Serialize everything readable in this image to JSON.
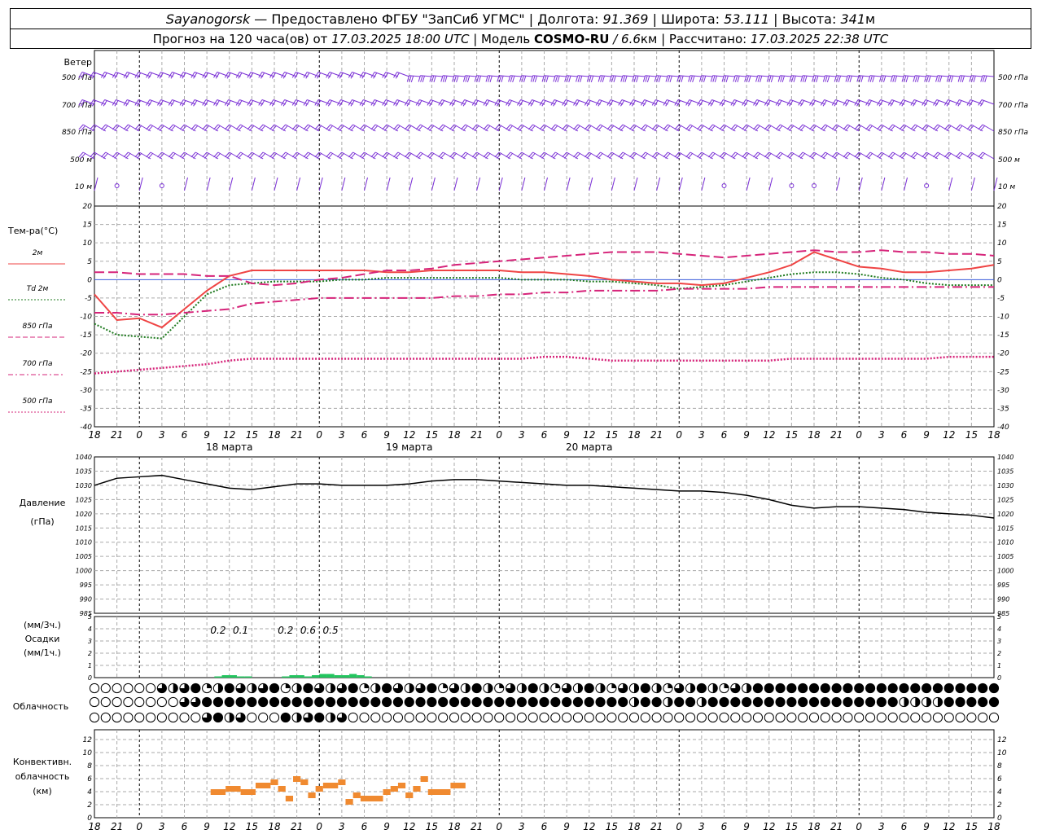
{
  "header": {
    "line1": {
      "station": "Sayanogorsk",
      "provider": " — Предоставлено ФГБУ \"ЗапСиб УГМС\" | Долгота: ",
      "lon": "91.369",
      "lat_label": " | Широта: ",
      "lat": "53.111",
      "alt_label": " | Высота: ",
      "alt": "341",
      "alt_unit": "м"
    },
    "line2": {
      "fc_label": "Прогноз на 120 часа(ов) от ",
      "fc_start": "17.03.2025 18:00 UTC",
      "model_label": " | Модель ",
      "model": "COSMO-RU",
      "res": " / 6.6",
      "res_unit": "км",
      "calc_label": " | Рассчитано: ",
      "calc": "17.03.2025 22:38 UTC"
    }
  },
  "chart_data": [
    {
      "type": "wind-barbs",
      "title": "Ветер",
      "levels": [
        "500 гПа",
        "700 гПа",
        "850 гПа",
        "500 м",
        "10 м"
      ],
      "color": "#7a2fd6",
      "calm_markers_10m_hours": [
        3,
        9,
        85,
        92,
        94,
        96,
        112
      ]
    },
    {
      "type": "line",
      "ylabel": "Тем-ра(°C)",
      "ylim": [
        -40,
        20
      ],
      "yticks": [
        20,
        15,
        10,
        5,
        0,
        -5,
        -10,
        -15,
        -20,
        -25,
        -30,
        -35,
        -40
      ],
      "x_hours": [
        0,
        3,
        6,
        9,
        12,
        15,
        18,
        21,
        24,
        27,
        30,
        33,
        36,
        39,
        42,
        45,
        48,
        51,
        54,
        57,
        60,
        63,
        66,
        69,
        72,
        75,
        78,
        81,
        84,
        87,
        90,
        93,
        96,
        99,
        102,
        105,
        108,
        111,
        114,
        117,
        120
      ],
      "series": [
        {
          "name": "2м",
          "color": "#ef4444",
          "style": "solid",
          "values": [
            -4,
            -11,
            -10.5,
            -13,
            -8,
            -3,
            1,
            2.5,
            2.5,
            2.5,
            2.5,
            2.5,
            2.5,
            2,
            2,
            2.5,
            2.5,
            2.5,
            2.5,
            2,
            2,
            1.5,
            1,
            0,
            -0.5,
            -1,
            -1,
            -1.5,
            -1,
            0.5,
            2,
            4,
            7.5,
            5.5,
            3.5,
            3,
            2,
            2,
            2.5,
            3,
            4
          ]
        },
        {
          "name": "Td 2м",
          "color": "#1e7a1e",
          "style": "dotted",
          "values": [
            -12,
            -15,
            -15.5,
            -16,
            -10,
            -4,
            -1.5,
            -1,
            -0.5,
            -0.5,
            -0.5,
            0,
            0,
            0.5,
            0.5,
            0.5,
            0.5,
            0.5,
            0.5,
            0,
            0,
            0,
            -0.5,
            -0.5,
            -1,
            -1.5,
            -2.5,
            -2,
            -1.5,
            -0.5,
            0.5,
            1.5,
            2,
            2,
            1.5,
            0.5,
            0,
            -1,
            -1.5,
            -1.5,
            -1.5
          ]
        },
        {
          "name": "850 гПа",
          "color": "#d6247a",
          "style": "dash",
          "values": [
            2,
            2,
            1.5,
            1.5,
            1.5,
            1,
            1,
            -1,
            -1.5,
            -1,
            0,
            0.5,
            1.5,
            2.5,
            2.5,
            3,
            4,
            4.5,
            5,
            5.5,
            6,
            6.5,
            7,
            7.5,
            7.5,
            7.5,
            7,
            6.5,
            6,
            6.5,
            7,
            7.5,
            8,
            7.5,
            7.5,
            8,
            7.5,
            7.5,
            7,
            7,
            6.5
          ]
        },
        {
          "name": "700 гПа",
          "color": "#d6247a",
          "style": "dashdot",
          "values": [
            -9,
            -9,
            -9.5,
            -9.5,
            -9,
            -8.5,
            -8,
            -6.5,
            -6,
            -5.5,
            -5,
            -5,
            -5,
            -5,
            -5,
            -5,
            -4.5,
            -4.5,
            -4,
            -4,
            -3.5,
            -3.5,
            -3,
            -3,
            -3,
            -3,
            -2.5,
            -2.5,
            -2.5,
            -2.5,
            -2,
            -2,
            -2,
            -2,
            -2,
            -2,
            -2,
            -2,
            -2,
            -2,
            -2
          ]
        },
        {
          "name": "500 гПа",
          "color": "#d6247a",
          "style": "dotted",
          "values": [
            -25.5,
            -25,
            -24.5,
            -24,
            -23.5,
            -23,
            -22,
            -21.5,
            -21.5,
            -21.5,
            -21.5,
            -21.5,
            -21.5,
            -21.5,
            -21.5,
            -21.5,
            -21.5,
            -21.5,
            -21.5,
            -21.5,
            -21,
            -21,
            -21.5,
            -22,
            -22,
            -22,
            -22,
            -22,
            -22,
            -22,
            -22,
            -21.5,
            -21.5,
            -21.5,
            -21.5,
            -21.5,
            -21.5,
            -21.5,
            -21,
            -21,
            -21
          ]
        }
      ],
      "x_tick_labels": [
        "18",
        "21",
        "0",
        "3",
        "6",
        "9",
        "12",
        "15",
        "18",
        "21",
        "0",
        "3",
        "6",
        "9",
        "12",
        "15",
        "18",
        "21",
        "0",
        "3",
        "6",
        "9",
        "12",
        "15",
        "18",
        "21",
        "0",
        "3",
        "6",
        "9",
        "12",
        "15",
        "18",
        "21",
        "0",
        "3",
        "6",
        "9",
        "12",
        "15",
        "18",
        "21",
        "0"
      ],
      "day_labels": [
        {
          "hour": 18,
          "label": "18 марта"
        },
        {
          "hour": 42,
          "label": "19 марта"
        },
        {
          "hour": 66,
          "label": "20 марта"
        }
      ]
    },
    {
      "type": "line",
      "ylabel": "Давление",
      "yunit": "(гПа)",
      "ylim": [
        985,
        1040
      ],
      "yticks": [
        1040,
        1035,
        1030,
        1025,
        1020,
        1015,
        1010,
        1005,
        1000,
        995,
        990,
        985
      ],
      "color": "#000000",
      "x_hours": [
        0,
        3,
        6,
        9,
        12,
        15,
        18,
        21,
        24,
        27,
        30,
        33,
        36,
        39,
        42,
        45,
        48,
        51,
        54,
        57,
        60,
        63,
        66,
        69,
        72,
        75,
        78,
        81,
        84,
        87,
        90,
        93,
        96,
        99,
        102,
        105,
        108,
        111,
        114,
        117,
        120
      ],
      "values": [
        1030,
        1032.5,
        1033,
        1033.5,
        1032,
        1030.5,
        1029,
        1028.5,
        1029.5,
        1030.5,
        1030.5,
        1030,
        1030,
        1030,
        1030.5,
        1031.5,
        1032,
        1032,
        1031.5,
        1031,
        1030.5,
        1030,
        1030,
        1029.5,
        1029,
        1028.5,
        1028,
        1028,
        1027.5,
        1026.5,
        1025,
        1023,
        1022,
        1022.5,
        1022.5,
        1022,
        1021.5,
        1020.5,
        1020,
        1019.5,
        1018.5
      ]
    },
    {
      "type": "bar",
      "ylabel_lines": [
        "(мм/3ч.)",
        "Осадки",
        "(мм/1ч.)"
      ],
      "ylim": [
        0,
        5
      ],
      "yticks": [
        5,
        4,
        3,
        2,
        1,
        0
      ],
      "color": "#22c55e",
      "hourly": [
        {
          "hour": 16,
          "value": 0.1
        },
        {
          "hour": 17,
          "value": 0.2
        },
        {
          "hour": 18,
          "value": 0.2
        },
        {
          "hour": 19,
          "value": 0.1
        },
        {
          "hour": 20,
          "value": 0.1
        },
        {
          "hour": 25,
          "value": 0.1
        },
        {
          "hour": 26,
          "value": 0.2
        },
        {
          "hour": 27,
          "value": 0.2
        },
        {
          "hour": 28,
          "value": 0.1
        },
        {
          "hour": 29,
          "value": 0.2
        },
        {
          "hour": 30,
          "value": 0.3
        },
        {
          "hour": 31,
          "value": 0.3
        },
        {
          "hour": 32,
          "value": 0.2
        },
        {
          "hour": 33,
          "value": 0.2
        },
        {
          "hour": 34,
          "value": 0.3
        },
        {
          "hour": 35,
          "value": 0.2
        },
        {
          "hour": 36,
          "value": 0.1
        }
      ],
      "three_hour_labels": [
        {
          "hour": 16.5,
          "label": "0.2"
        },
        {
          "hour": 19.5,
          "label": "0.1"
        },
        {
          "hour": 25.5,
          "label": "0.2"
        },
        {
          "hour": 28.5,
          "label": "0.6"
        },
        {
          "hour": 31.5,
          "label": "0.5"
        }
      ]
    },
    {
      "type": "symbols",
      "ylabel": "Облачность",
      "rows": [
        "upper",
        "middle",
        "lower"
      ],
      "step_hours": 1.5,
      "description_levels": "fraction of circle filled (0=clear, 1=overcast)",
      "upper_overcast_from_hour": 90,
      "middle_overcast_from_hour": 15,
      "lower_cloud_hours": [
        15,
        16.5,
        18,
        19.5,
        25.5,
        27,
        28.5,
        30,
        31.5,
        33
      ]
    },
    {
      "type": "bar",
      "ylabel_lines": [
        "Конвективн.",
        "облачность",
        "(км)"
      ],
      "ylim": [
        0,
        12
      ],
      "yticks": [
        12,
        10,
        8,
        6,
        4,
        2,
        0
      ],
      "color": "#f08a30",
      "segments": [
        {
          "x0": 15.5,
          "x1": 17.5,
          "value": 4
        },
        {
          "x0": 17.5,
          "x1": 19.5,
          "value": 4.5
        },
        {
          "x0": 19.5,
          "x1": 21.5,
          "value": 4
        },
        {
          "x0": 21.5,
          "x1": 23.5,
          "value": 5
        },
        {
          "x0": 23.5,
          "x1": 24.5,
          "value": 5.5
        },
        {
          "x0": 24.5,
          "x1": 25.5,
          "value": 4.5
        },
        {
          "x0": 25.5,
          "x1": 26.5,
          "value": 3
        },
        {
          "x0": 26.5,
          "x1": 27.5,
          "value": 6
        },
        {
          "x0": 27.5,
          "x1": 28.5,
          "value": 5.5
        },
        {
          "x0": 28.5,
          "x1": 29.5,
          "value": 3.5
        },
        {
          "x0": 29.5,
          "x1": 30.5,
          "value": 4.5
        },
        {
          "x0": 30.5,
          "x1": 32.5,
          "value": 5
        },
        {
          "x0": 32.5,
          "x1": 33.5,
          "value": 5.5
        },
        {
          "x0": 33.5,
          "x1": 34.5,
          "value": 2.5
        },
        {
          "x0": 34.5,
          "x1": 35.5,
          "value": 3.5
        },
        {
          "x0": 35.5,
          "x1": 38.5,
          "value": 3
        },
        {
          "x0": 38.5,
          "x1": 39.5,
          "value": 4
        },
        {
          "x0": 39.5,
          "x1": 40.5,
          "value": 4.5
        },
        {
          "x0": 40.5,
          "x1": 41.5,
          "value": 5
        },
        {
          "x0": 41.5,
          "x1": 42.5,
          "value": 3.5
        },
        {
          "x0": 42.5,
          "x1": 43.5,
          "value": 4.5
        },
        {
          "x0": 43.5,
          "x1": 44.5,
          "value": 6
        },
        {
          "x0": 44.5,
          "x1": 47.5,
          "value": 4
        },
        {
          "x0": 47.5,
          "x1": 49.5,
          "value": 5
        }
      ]
    }
  ]
}
